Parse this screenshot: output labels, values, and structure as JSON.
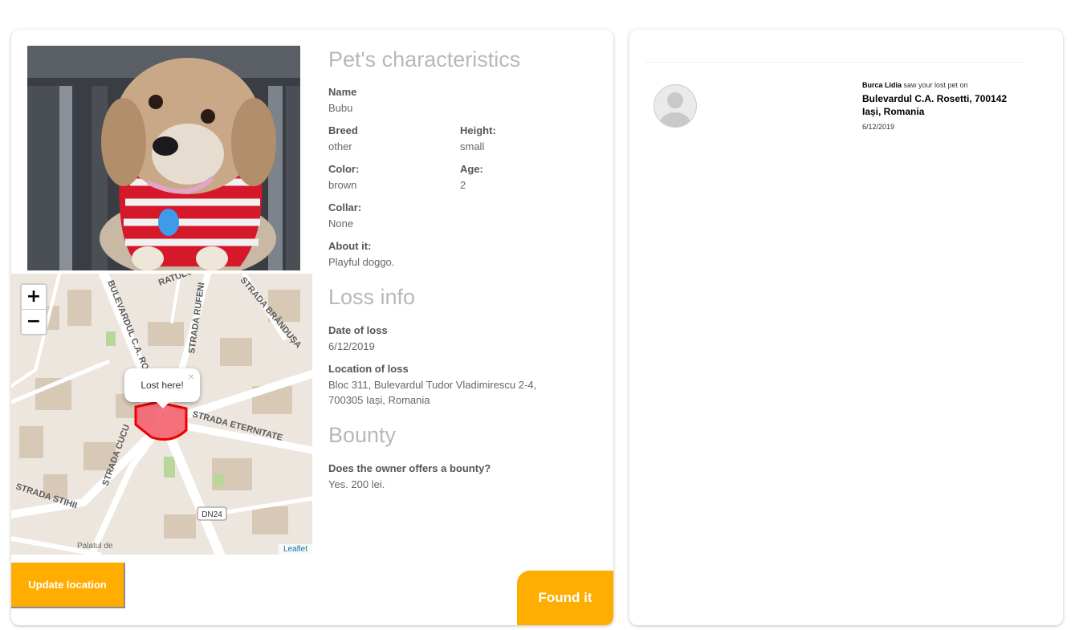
{
  "pet_info": {
    "characteristics_title": "Pet's characteristics",
    "name_label": "Name",
    "name": "Bubu",
    "breed_label": "Breed",
    "breed": "other",
    "height_label": "Height:",
    "height": "small",
    "color_label": "Color:",
    "color": "brown",
    "age_label": "Age:",
    "age": "2",
    "collar_label": "Collar:",
    "collar": "None",
    "about_label": "About it:",
    "about": "Playful doggo."
  },
  "loss_info": {
    "title": "Loss info",
    "date_label": "Date of loss",
    "date": "6/12/2019",
    "location_label": "Location of loss",
    "location": "Bloc 311, Bulevardul Tudor Vladimirescu 2-4, 700305 Iași, Romania"
  },
  "bounty": {
    "title": "Bounty",
    "question_label": "Does the owner offers a bounty?",
    "answer": "Yes. 200 lei."
  },
  "map": {
    "zoom_in": "+",
    "zoom_out": "−",
    "popup_text": "Lost here!",
    "popup_close": "×",
    "attribution": "Leaflet",
    "street_labels": [
      "BULEVARDUL C.A. ROSETTI",
      "STRADA RUFENI",
      "STRADA BRÂNDUȘA",
      "STRADA ETERNITATE",
      "STRADA CUCU",
      "STRADA STIHII",
      "DN24",
      "Palatul de justiție",
      "RATULUI"
    ]
  },
  "actions": {
    "update_location": "Update location",
    "found_it": "Found it"
  },
  "sightings": [
    {
      "user": "Burca Lidia",
      "action_text": "saw your lost pet on",
      "address_line1": "Bulevardul C.A. Rosetti, 700142",
      "address_line2": "Iași, Romania",
      "date": "6/12/2019"
    }
  ],
  "colors": {
    "accent": "#ffad00",
    "section_title": "#b8b8b8",
    "marker_fill": "#f2606e",
    "marker_stroke": "#ee0000"
  }
}
